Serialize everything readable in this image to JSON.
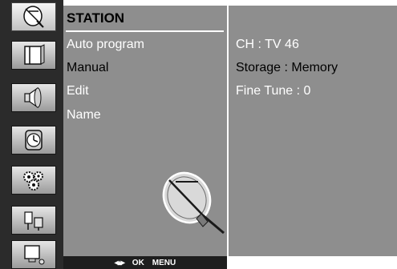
{
  "sidebar": {
    "icons": [
      {
        "name": "station-icon",
        "selected": true
      },
      {
        "name": "picture-icon",
        "selected": false
      },
      {
        "name": "sound-icon",
        "selected": false
      },
      {
        "name": "time-icon",
        "selected": false
      },
      {
        "name": "option-icon",
        "selected": false
      },
      {
        "name": "input-icon",
        "selected": false
      },
      {
        "name": "pc-icon",
        "selected": false
      }
    ]
  },
  "menu": {
    "title": "STATION",
    "items": [
      {
        "label": "Auto program",
        "highlighted": false
      },
      {
        "label": "Manual",
        "highlighted": true
      },
      {
        "label": "Edit",
        "highlighted": false
      },
      {
        "label": "Name",
        "highlighted": false
      }
    ]
  },
  "info": {
    "lines": [
      {
        "text": "CH : TV 46",
        "highlighted": false
      },
      {
        "text": "Storage : Memory",
        "highlighted": true
      },
      {
        "text": "Fine Tune : 0",
        "highlighted": false
      }
    ]
  },
  "hint_bar": {
    "nav_glyph": "◂▴▸",
    "ok_label": "OK",
    "menu_label": "MENU"
  },
  "colors": {
    "panel": "#8e8e8e",
    "icon_column": "#2b2b2b",
    "bar": "#1e1e1e"
  }
}
